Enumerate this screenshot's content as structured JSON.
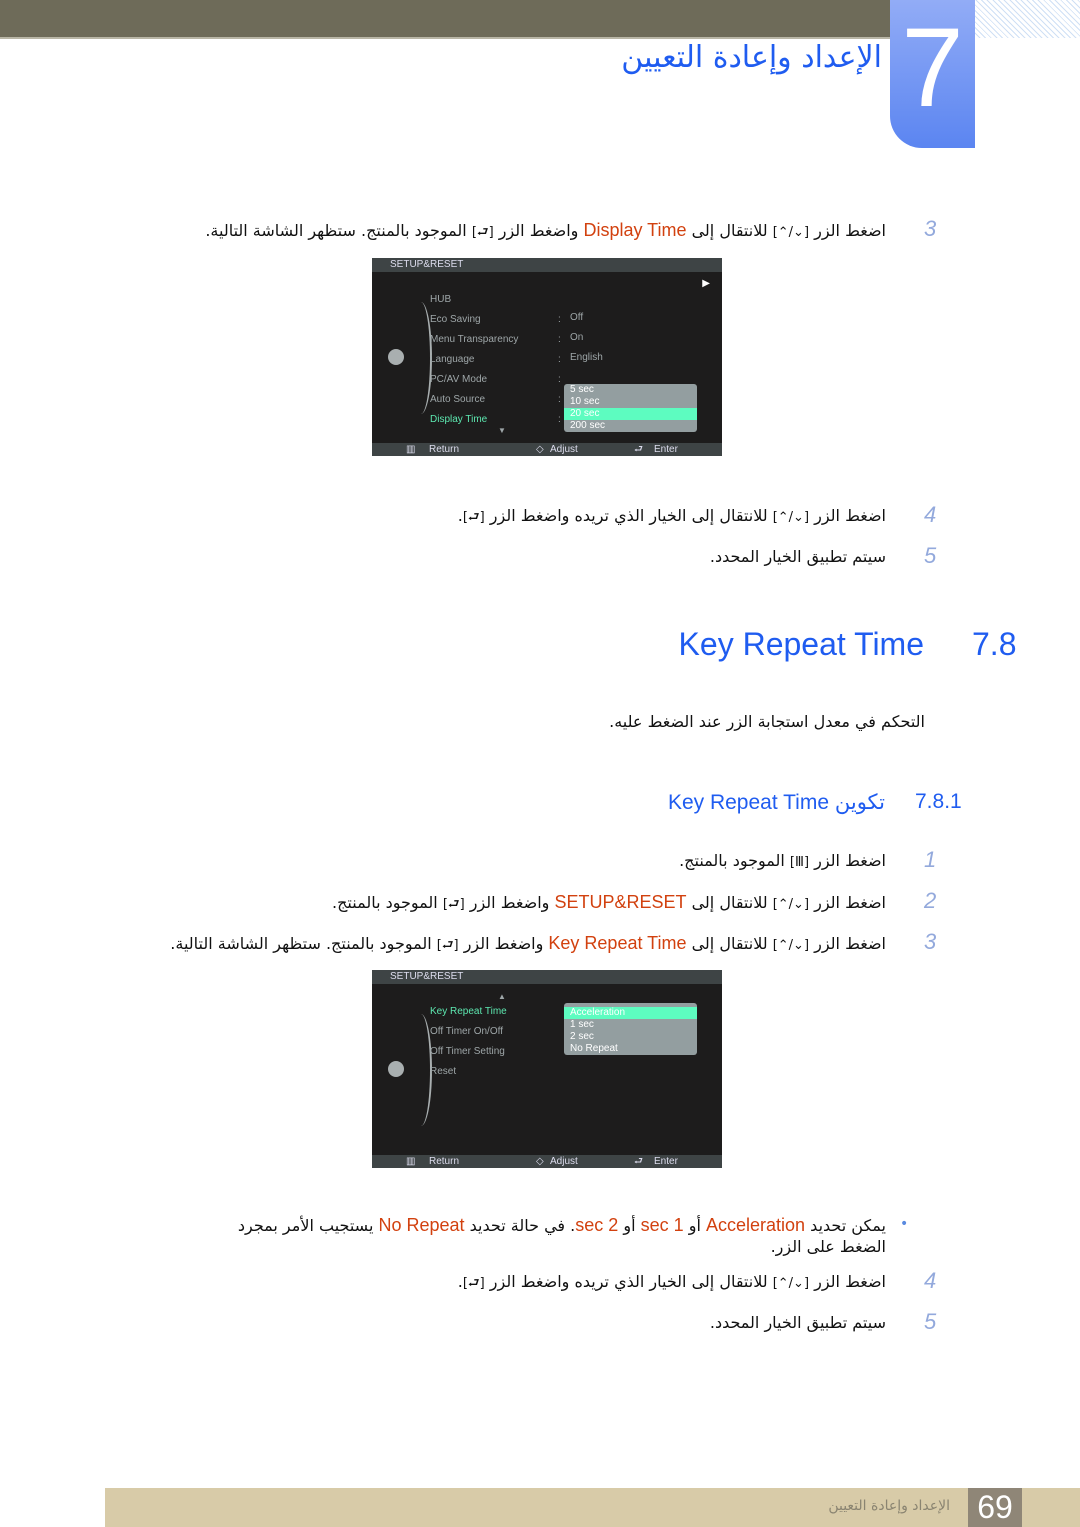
{
  "header": {
    "chapter_number": "7",
    "chapter_title": "الإعداد وإعادة التعيين"
  },
  "section1_steps": [
    {
      "num": "3",
      "segs": [
        {
          "t": "اضغط الزر "
        },
        {
          "icon": "up-down-icon",
          "t": "[⌃/⌄]"
        },
        {
          "t": " للانتقال إلى "
        },
        {
          "hl": true,
          "t": "Display Time"
        },
        {
          "t": " واضغط الزر "
        },
        {
          "icon": "enter-icon",
          "t": "[⮐]"
        },
        {
          "t": " الموجود بالمنتج. ستظهر الشاشة التالية."
        }
      ]
    },
    {
      "num": "4",
      "segs": [
        {
          "t": "اضغط الزر "
        },
        {
          "icon": "up-down-icon",
          "t": "[⌃/⌄]"
        },
        {
          "t": " للانتقال إلى الخيار الذي تريده واضغط الزر "
        },
        {
          "icon": "enter-icon",
          "t": "[⮐]"
        },
        {
          "t": "."
        }
      ]
    },
    {
      "num": "5",
      "segs": [
        {
          "t": "سيتم تطبيق الخيار المحدد."
        }
      ]
    }
  ],
  "osd1": {
    "title": "SETUP&RESET",
    "items": [
      "HUB",
      "Eco Saving",
      "Menu Transparency",
      "Language",
      "PC/AV Mode",
      "Auto Source",
      "Display Time"
    ],
    "values": [
      "",
      "Off",
      "On",
      "English",
      "",
      "",
      ""
    ],
    "options": [
      "5 sec",
      "10 sec",
      "20 sec",
      "200 sec"
    ],
    "selected_option": "20 sec",
    "footer": {
      "return": "Return",
      "adjust": "Adjust",
      "enter": "Enter"
    }
  },
  "section": {
    "number": "7.8",
    "title": "Key Repeat Time",
    "description": "التحكم في معدل استجابة الزر عند الضغط عليه."
  },
  "subsection": {
    "number": "7.8.1",
    "title": "تكوين Key Repeat Time"
  },
  "section2_steps": [
    {
      "num": "1",
      "segs": [
        {
          "t": "اضغط الزر "
        },
        {
          "icon": "menu-icon",
          "t": "[Ⅲ]"
        },
        {
          "t": " الموجود بالمنتج."
        }
      ]
    },
    {
      "num": "2",
      "segs": [
        {
          "t": "اضغط الزر "
        },
        {
          "icon": "up-down-icon",
          "t": "[⌃/⌄]"
        },
        {
          "t": " للانتقال إلى "
        },
        {
          "hl": true,
          "t": "SETUP&RESET"
        },
        {
          "t": " واضغط الزر "
        },
        {
          "icon": "enter-icon",
          "t": "[⮐]"
        },
        {
          "t": " الموجود بالمنتج."
        }
      ]
    },
    {
      "num": "3",
      "segs": [
        {
          "t": "اضغط الزر "
        },
        {
          "icon": "up-down-icon",
          "t": "[⌃/⌄]"
        },
        {
          "t": " للانتقال إلى "
        },
        {
          "hl": true,
          "t": "Key Repeat Time"
        },
        {
          "t": " واضغط الزر "
        },
        {
          "icon": "enter-icon",
          "t": "[⮐]"
        },
        {
          "t": " الموجود بالمنتج. ستظهر الشاشة التالية."
        }
      ]
    }
  ],
  "osd2": {
    "title": "SETUP&RESET",
    "items": [
      "Key Repeat Time",
      "Off Timer On/Off",
      "Off Timer Setting",
      "Reset"
    ],
    "options": [
      "Acceleration",
      "1 sec",
      "2 sec",
      "No Repeat"
    ],
    "selected_option": "Acceleration",
    "footer": {
      "return": "Return",
      "adjust": "Adjust",
      "enter": "Enter"
    }
  },
  "note": {
    "line1": [
      {
        "t": "يمكن تحديد "
      },
      {
        "hl": true,
        "t": "Acceleration"
      },
      {
        "t": " أو "
      },
      {
        "hl": true,
        "t": "1 sec"
      },
      {
        "t": " أو "
      },
      {
        "hl": true,
        "t": "2 sec"
      },
      {
        "t": ". في حالة تحديد "
      },
      {
        "hl": true,
        "t": "No Repeat"
      },
      {
        "t": " يستجيب الأمر بمجرد"
      }
    ],
    "line2": "الضغط على الزر."
  },
  "section3_steps": [
    {
      "num": "4",
      "segs": [
        {
          "t": "اضغط الزر "
        },
        {
          "icon": "up-down-icon",
          "t": "[⌃/⌄]"
        },
        {
          "t": " للانتقال إلى الخيار الذي تريده واضغط الزر "
        },
        {
          "icon": "enter-icon",
          "t": "[⮐]"
        },
        {
          "t": "."
        }
      ]
    },
    {
      "num": "5",
      "segs": [
        {
          "t": "سيتم تطبيق الخيار المحدد."
        }
      ]
    }
  ],
  "footer": {
    "page_number": "69",
    "chapter_title": "الإعداد وإعادة التعيين"
  },
  "colors": {
    "accent": "#1f5cf0",
    "highlight": "#d2410f",
    "osd_selected": "#5dfcc0"
  }
}
